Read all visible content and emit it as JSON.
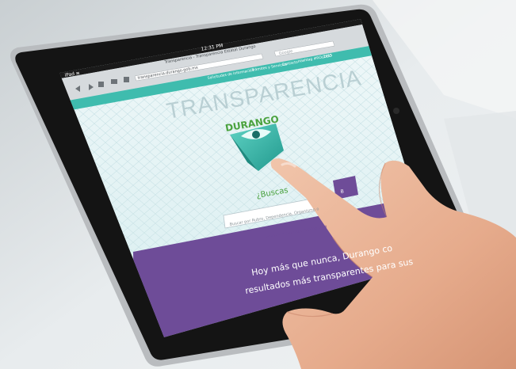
{
  "device": {
    "label": "iPad",
    "time": "12:31 PM",
    "icon": "wifi-icon"
  },
  "browser": {
    "window_title": "Transparencia - Transparencia Estatal Durango",
    "address": "transparencia.durango.gob.mx",
    "search_placeholder": "Google",
    "icons": [
      "back-icon",
      "forward-icon",
      "tabs-icon",
      "bookmarks-icon",
      "share-icon"
    ]
  },
  "site": {
    "nav": [
      "Solicitudes de información",
      "Trámites y Servicios",
      "Contacto",
      "Hashtag #ROLDGO",
      "2015"
    ],
    "title": "TRANSPARENCIA",
    "subtitle": "DURANGO",
    "logo_icon": "eye-logo-icon",
    "search_heading": "¿Buscas",
    "search_placeholder": "Buscar por Rubro, Dependencia, Organismo o",
    "search_button": "B",
    "helper_link": "Encuéntralo más rápido que",
    "banner_line1": "Hoy más que nunca, Durango co",
    "banner_line2": "resultados más transparentes para sus"
  },
  "colors": {
    "accent_teal": "#3fbcae",
    "purple": "#6e4c98",
    "green_text": "#4aa23e",
    "page_bg": "#dff0f2",
    "bezel": "#141414"
  }
}
